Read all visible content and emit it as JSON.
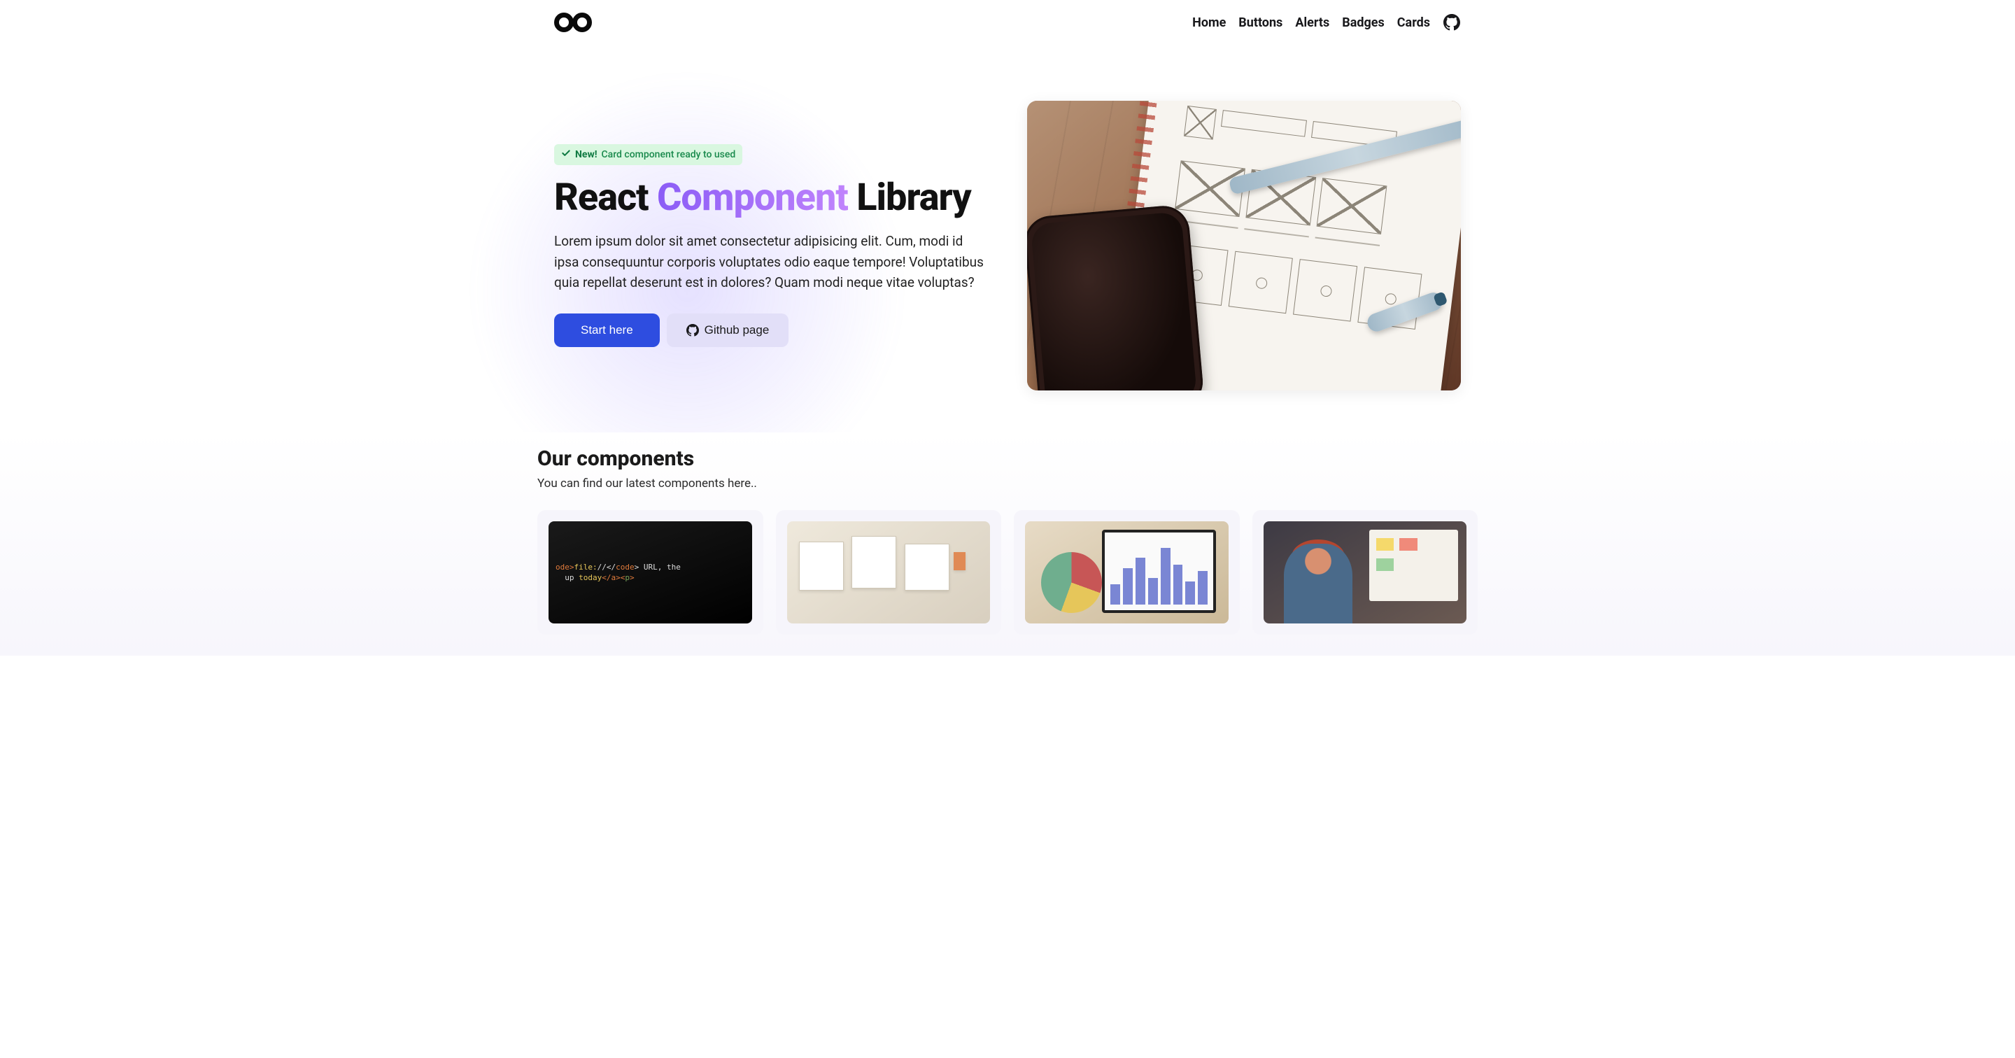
{
  "nav": {
    "items": [
      {
        "label": "Home"
      },
      {
        "label": "Buttons"
      },
      {
        "label": "Alerts"
      },
      {
        "label": "Badges"
      },
      {
        "label": "Cards"
      }
    ]
  },
  "hero": {
    "badge_new": "New!",
    "badge_text": "Card component ready to used",
    "title_1": "React",
    "title_2": "Component",
    "title_3": "Library",
    "description": "Lorem ipsum dolor sit amet consectetur adipisicing elit. Cum, modi id ipsa consequuntur corporis voluptates odio eaque tempore! Voluptatibus quia repellat deserunt est in dolores? Quam modi neque vitae voluptas?",
    "cta_primary": "Start here",
    "cta_secondary": "Github page"
  },
  "section": {
    "title": "Our components",
    "subtitle": "You can find our latest components here.."
  }
}
